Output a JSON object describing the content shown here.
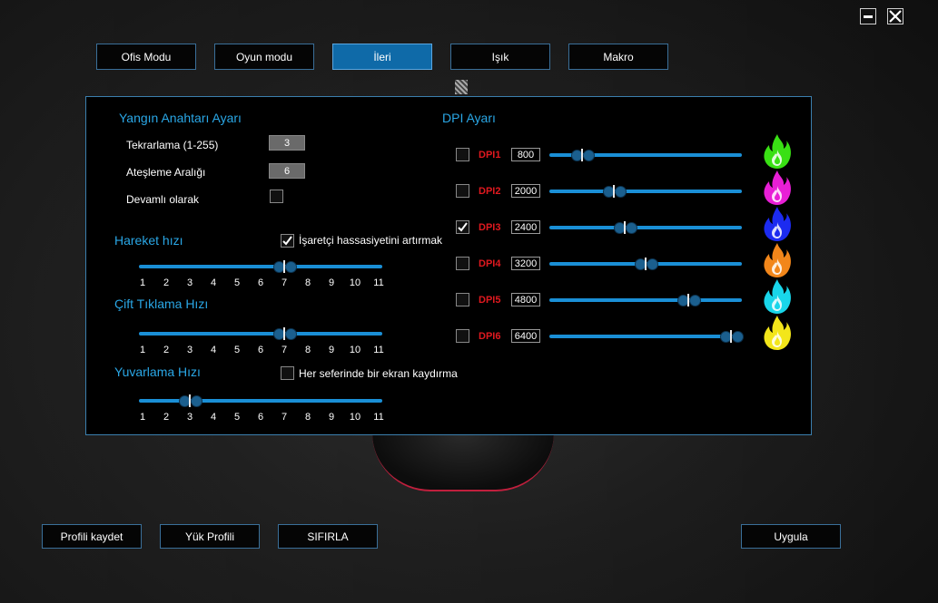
{
  "tabs": [
    {
      "label": "Ofis Modu",
      "active": false
    },
    {
      "label": "Oyun modu",
      "active": false
    },
    {
      "label": "İleri",
      "active": true
    },
    {
      "label": "Işık",
      "active": false
    },
    {
      "label": "Makro",
      "active": false
    }
  ],
  "fire_key": {
    "title": "Yangın Anahtarı Ayarı",
    "repeat_label": "Tekrarlama (1-255)",
    "repeat_value": "3",
    "interval_label": "Ateşleme Aralığı",
    "interval_value": "6",
    "continuous_label": "Devamlı olarak",
    "continuous_checked": false
  },
  "movement": {
    "title": "Hareket hızı",
    "pointer_label": "İşaretçi hassasiyetini artırmak",
    "pointer_checked": true,
    "value": 7,
    "ticks": [
      "1",
      "2",
      "3",
      "4",
      "5",
      "6",
      "7",
      "8",
      "9",
      "10",
      "11"
    ]
  },
  "double_click": {
    "title": "Çift Tıklama Hızı",
    "value": 7,
    "ticks": [
      "1",
      "2",
      "3",
      "4",
      "5",
      "6",
      "7",
      "8",
      "9",
      "10",
      "11"
    ]
  },
  "scroll": {
    "title": "Yuvarlama Hızı",
    "screen_label": "Her seferinde bir ekran kaydırma",
    "screen_checked": false,
    "value": 3,
    "ticks": [
      "1",
      "2",
      "3",
      "4",
      "5",
      "6",
      "7",
      "8",
      "9",
      "10",
      "11"
    ]
  },
  "dpi": {
    "title": "DPI Ayarı",
    "min": 0,
    "max": 6400,
    "rows": [
      {
        "label": "DPI1",
        "value": "800",
        "checked": false,
        "color": "#39e014"
      },
      {
        "label": "DPI2",
        "value": "2000",
        "checked": false,
        "color": "#e81fd6"
      },
      {
        "label": "DPI3",
        "value": "2400",
        "checked": true,
        "color": "#1c2bf0"
      },
      {
        "label": "DPI4",
        "value": "3200",
        "checked": false,
        "color": "#f2861a"
      },
      {
        "label": "DPI5",
        "value": "4800",
        "checked": false,
        "color": "#19d6ea"
      },
      {
        "label": "DPI6",
        "value": "6400",
        "checked": false,
        "color": "#f3e61a"
      }
    ]
  },
  "footer": {
    "save": "Profili kaydet",
    "load": "Yük Profili",
    "reset": "SIFIRLA",
    "apply": "Uygula"
  },
  "colors": {
    "accent": "#2aa7e6",
    "active_tab": "#0f6aa8",
    "dpi_label": "#e0191f"
  }
}
